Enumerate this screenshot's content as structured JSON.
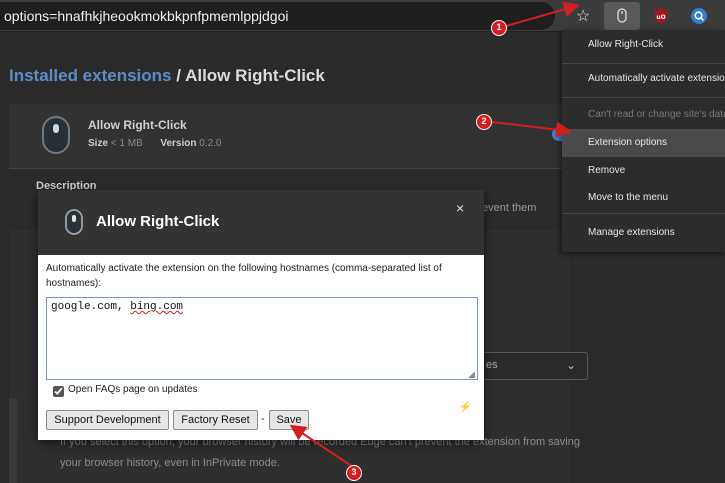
{
  "browser": {
    "url": "options=hnafhkjheookmokbkpnfpmemlppjdgoi"
  },
  "page": {
    "breadcrumb_link": "Installed extensions",
    "breadcrumb_separator": "/",
    "breadcrumb_current": "Allow Right-Click",
    "extension_name": "Allow Right-Click",
    "size_label": "Size",
    "size_value": "< 1 MB",
    "version_label": "Version",
    "version_value": "0.2.0",
    "description_heading": "Description",
    "background_fragment": "event them",
    "select_value_fragment": "es",
    "background_paragraph": "If you select this option, your browser history will be recorded Edge can't prevent the extension from saving your browser history, even in InPrivate mode."
  },
  "context_menu": {
    "items": [
      {
        "label": "Allow Right-Click"
      },
      {
        "label": "Automatically activate extension"
      },
      {
        "label": "Can't read or change site's data"
      },
      {
        "label": "Extension options"
      },
      {
        "label": "Remove"
      },
      {
        "label": "Move to the menu"
      },
      {
        "label": "Manage extensions"
      }
    ]
  },
  "dialog": {
    "title": "Allow Right-Click",
    "close_glyph": "×",
    "instructions": "Automatically activate the extension on the following hostnames (comma-separated list of hostnames):",
    "hostnames_part1": "google.com, ",
    "hostnames_part2": "bing.com",
    "checkbox_label": "Open FAQs page on updates",
    "checkbox_checked": true,
    "buttons": {
      "support": "Support Development",
      "reset": "Factory Reset",
      "dash": "-",
      "save": "Save"
    }
  },
  "annotations": {
    "badge_1": "1",
    "badge_2": "2",
    "badge_3": "3",
    "color": "#d11f1f"
  }
}
